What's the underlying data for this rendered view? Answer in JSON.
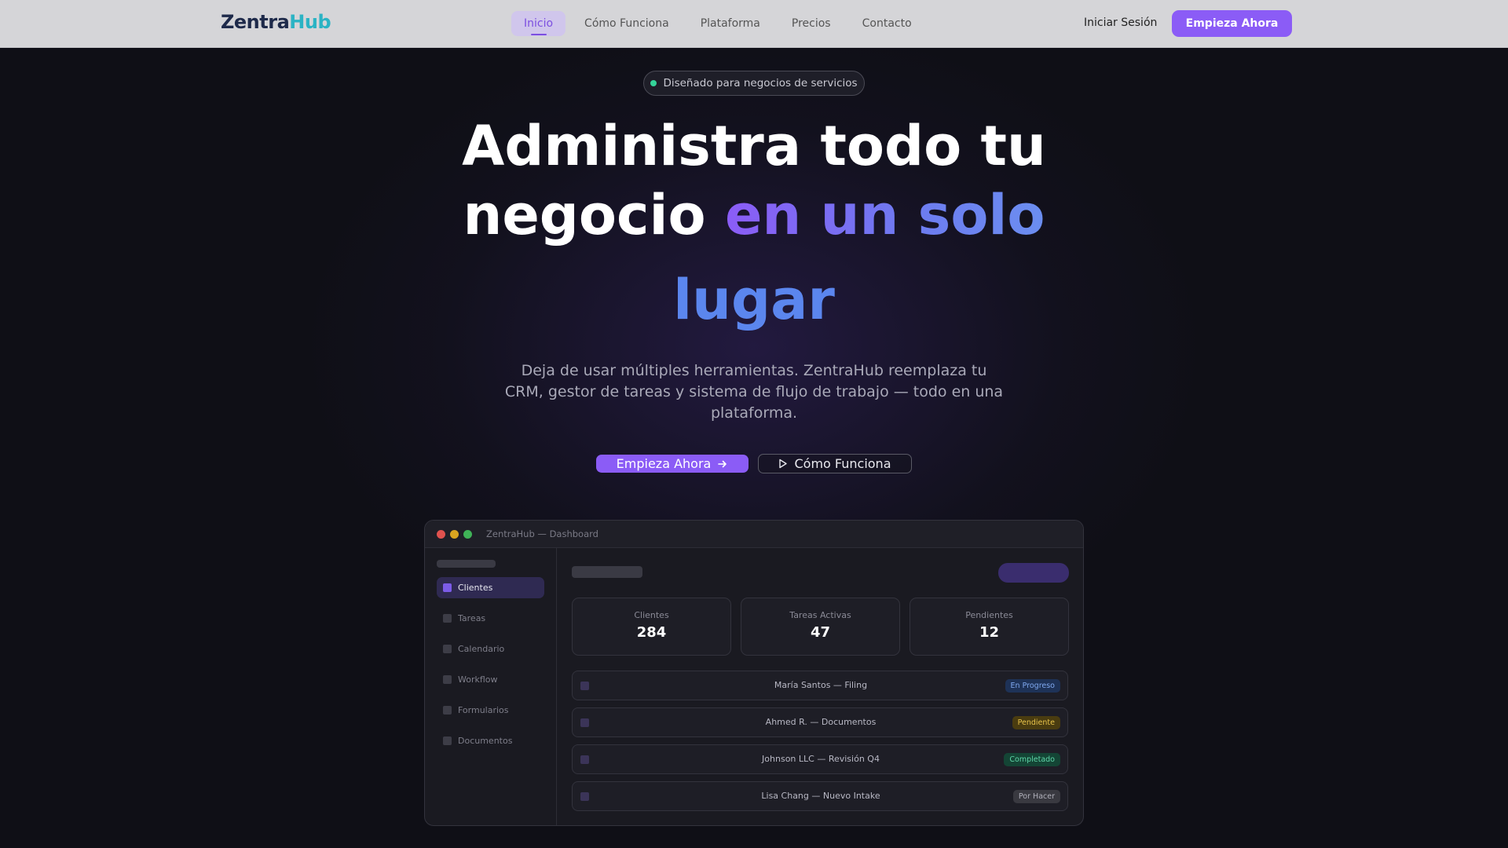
{
  "nav": {
    "logo_a": "Zentra",
    "logo_b": "Hub",
    "links": [
      "Inicio",
      "Cómo Funciona",
      "Plataforma",
      "Precios",
      "Contacto"
    ],
    "login": "Iniciar Sesión",
    "cta": "Empieza Ahora"
  },
  "hero": {
    "badge": "Diseñado para negocios de servicios",
    "title_line1": "Administra todo tu",
    "title_line2_plain": "negocio ",
    "title_line2_accent": "en un solo",
    "title_line3_accent": "lugar",
    "subtitle": "Deja de usar múltiples herramientas. ZentraHub reemplaza tu CRM, gestor de tareas y sistema de flujo de trabajo — todo en una plataforma.",
    "primary_cta": "Empieza Ahora",
    "secondary_cta": "Cómo Funciona"
  },
  "dashboard": {
    "window_title": "ZentraHub — Dashboard",
    "sidebar": [
      "Clientes",
      "Tareas",
      "Calendario",
      "Workflow",
      "Formularios",
      "Documentos"
    ],
    "stats": [
      {
        "label": "Clientes",
        "value": "284"
      },
      {
        "label": "Tareas Activas",
        "value": "47"
      },
      {
        "label": "Pendientes",
        "value": "12"
      }
    ],
    "rows": [
      {
        "text": "María Santos — Filing",
        "status": "En Progreso"
      },
      {
        "text": "Ahmed R. — Documentos",
        "status": "Pendiente"
      },
      {
        "text": "Johnson LLC — Revisión Q4",
        "status": "Completado"
      },
      {
        "text": "Lisa Chang — Nuevo Intake",
        "status": "Por Hacer"
      }
    ]
  },
  "colors": {
    "accent": "#8b5cf6",
    "status_in_progress": "#3b82f6",
    "status_pending": "#eab308",
    "status_done": "#34d399",
    "status_todo": "#9ca3af"
  }
}
